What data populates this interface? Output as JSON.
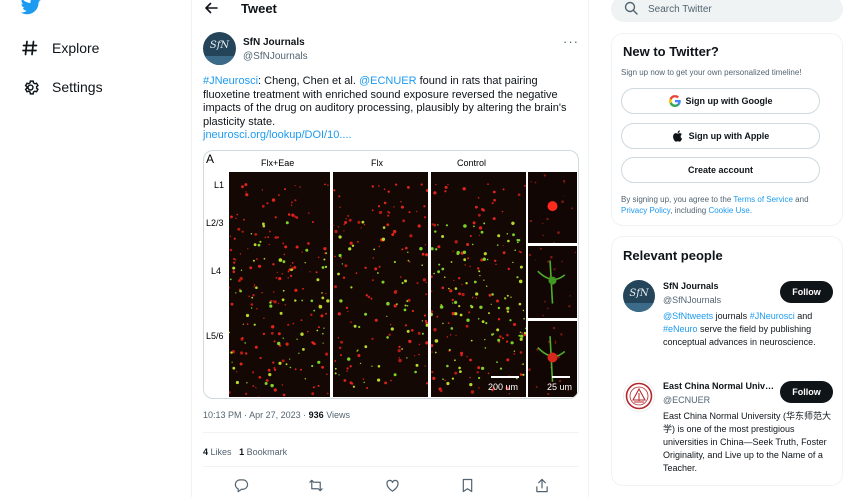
{
  "nav": {
    "logo": "twitter-bird-icon",
    "items": [
      {
        "label": "Explore",
        "icon": "hashtag-icon"
      },
      {
        "label": "Settings",
        "icon": "gear-icon"
      }
    ]
  },
  "header": {
    "title": "Tweet"
  },
  "tweet": {
    "author_name": "SfN Journals",
    "author_handle": "@SfNJournals",
    "avatar_text": "SfN",
    "text_parts": {
      "hashtag": "#JNeurosci",
      "t1": ": Cheng, Chen et al. ",
      "mention": "@ECNUER",
      "t2": " found in rats that pairing fluoxetine treatment with enriched sound exposure reversed the negative impacts of the drug on auditory processing, plausibly by altering the brain's plasticity state."
    },
    "link": "jneurosci.org/lookup/DOI/10....",
    "figure": {
      "letter": "A",
      "panels": [
        "Flx+Eae",
        "Flx",
        "Control"
      ],
      "layers": [
        "L1",
        "L2/3",
        "L4",
        "L5/6"
      ],
      "scale_main": "200 um",
      "scale_zoom": "25 um"
    },
    "time": "10:13 PM",
    "date": "Apr 27, 2023",
    "separator": "·",
    "views_count": "936",
    "views_label": "Views",
    "likes_count": "4",
    "likes_label": "Likes",
    "bookmarks_count": "1",
    "bookmarks_label": "Bookmark"
  },
  "search": {
    "placeholder": "Search Twitter"
  },
  "new_to_twitter": {
    "title": "New to Twitter?",
    "subtitle": "Sign up now to get your own personalized timeline!",
    "google_label": "Sign up with Google",
    "apple_label": "Sign up with Apple",
    "create_label": "Create account",
    "legal_t1": "By signing up, you agree to the ",
    "legal_terms": "Terms of Service",
    "legal_t2": " and ",
    "legal_privacy": "Privacy Policy",
    "legal_t3": ", including ",
    "legal_cookie": "Cookie Use",
    "legal_t4": "."
  },
  "relevant_people": {
    "title": "Relevant people",
    "people": [
      {
        "name": "SfN Journals",
        "handle": "@SfNJournals",
        "follow_label": "Follow",
        "bio_l1": "@SfNtweets",
        "bio_t1": " journals ",
        "bio_l2": "#JNeurosci",
        "bio_t2": " and ",
        "bio_l3": "#eNeuro",
        "bio_t3": " serve the field by publishing conceptual advances in neuroscience."
      },
      {
        "name": "East China Normal University",
        "handle": "@ECNUER",
        "follow_label": "Follow",
        "bio": "East China Normal University (华东师范大学) is one of the most prestigious universities in China—Seek Truth, Foster Originality, and Live up to the Name of a Teacher."
      }
    ]
  },
  "colors": {
    "accent": "#1d9bf0",
    "text": "#0f1419",
    "muted": "#536471",
    "follow_bg": "#0f1419",
    "ecnu_red": "#b5282e"
  }
}
